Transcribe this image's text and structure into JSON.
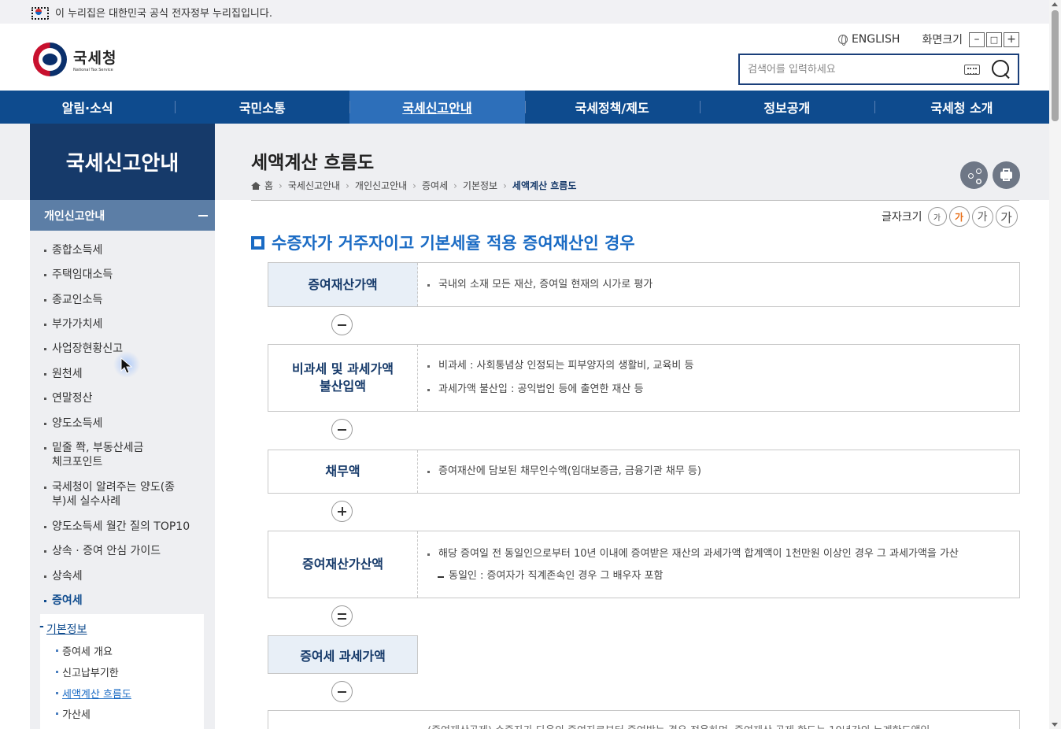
{
  "gov_notice": "이 누리집은 대한민국 공식 전자정부 누리집입니다.",
  "logo": {
    "name": "국세청",
    "en": "National Tax Service"
  },
  "header": {
    "english": "ENGLISH",
    "screen_size_label": "화면크기",
    "size_minus": "–",
    "size_reset": "□",
    "size_plus": "+",
    "search_placeholder": "검색어를 입력하세요"
  },
  "gnb": [
    "알림·소식",
    "국민소통",
    "국세신고안내",
    "국세정책/제도",
    "정보공개",
    "국세청 소개"
  ],
  "gnb_active": 2,
  "sidebar": {
    "title": "국세신고안내",
    "sub_title": "개인신고안내",
    "items": [
      "종합소득세",
      "주택임대소득",
      "종교인소득",
      "부가가치세",
      "사업장현황신고",
      "원천세",
      "연말정산",
      "양도소득세",
      "밑줄 쫙, 부동산세금 체크포인트",
      "국세청이 알려주는 양도(종부)세 실수사례",
      "양도소득세 월간 질의 TOP10",
      "상속 · 증여 안심 가이드",
      "상속세",
      "증여세"
    ],
    "active_item": 13,
    "submenu": {
      "heading": "기본정보",
      "items": [
        "증여세 개요",
        "신고납부기한",
        "세액계산 흐름도",
        "가산세"
      ],
      "active": 2
    }
  },
  "page": {
    "title": "세액계산 흐름도",
    "breadcrumb": [
      "홈",
      "국세신고안내",
      "개인신고안내",
      "증여세",
      "기본정보",
      "세액계산 흐름도"
    ],
    "font_size_label": "글자크기",
    "font_size_options": [
      "가",
      "가",
      "가",
      "가"
    ],
    "section_title": "수증자가 거주자이고 기본세율 적용 증여재산인 경우"
  },
  "flow": [
    {
      "label": "증여재산가액",
      "desc": [
        "국내외 소재 모든 재산, 증여일 현재의 시가로 평가"
      ]
    },
    {
      "operator": "minus"
    },
    {
      "label": "비과세 및 과세가액 불산입액",
      "desc": [
        "비과세 : 사회통념상 인정되는 피부양자의 생활비, 교육비 등",
        "과세가액 불산입 : 공익법인 등에 출연한 재산 등"
      ]
    },
    {
      "operator": "minus"
    },
    {
      "label": "채무액",
      "desc": [
        "증여재산에 담보된 채무인수액(임대보증금, 금융기관 채무 등)"
      ]
    },
    {
      "operator": "plus"
    },
    {
      "label": "증여재산가산액",
      "desc": [
        "해당 증여일 전 동일인으로부터 10년 이내에 증여받은 재산의 과세가액 합계액이 1천만원 이상인 경우 그 과세가액을 가산"
      ],
      "sub": [
        "동일인 : 증여자가 직계존속인 경우 그 배우자 포함"
      ]
    },
    {
      "operator": "equals"
    },
    {
      "label": "증여세 과세가액"
    },
    {
      "operator": "minus"
    },
    {
      "partial_text": "(증여재산공제) 수증자가 다음의 증여자로부터 증여받는 경우 적용하며, 증여재산 공제 한도는 10년간의 누계한도액임"
    }
  ]
}
